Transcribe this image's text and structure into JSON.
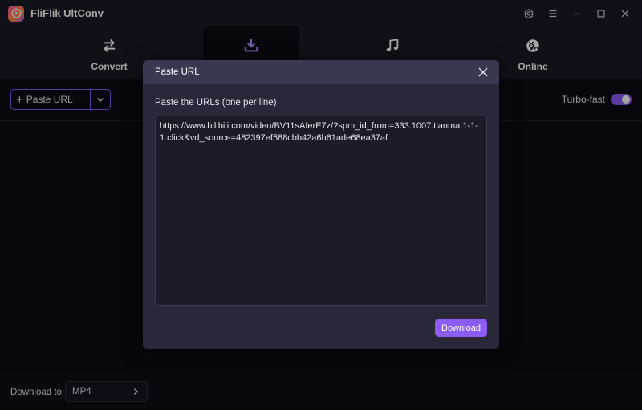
{
  "app": {
    "title": "FliFlik UltConv",
    "logo_icon": "play-logo-icon",
    "brand_gradient": [
      "#ff5fa2",
      "#ff8a3d",
      "#a855f7"
    ]
  },
  "window_controls": [
    {
      "name": "settings",
      "icon": "gear-icon"
    },
    {
      "name": "menu",
      "icon": "hamburger-menu-icon"
    },
    {
      "name": "minimize",
      "icon": "minimize-icon"
    },
    {
      "name": "maximize",
      "icon": "maximize-icon"
    },
    {
      "name": "close",
      "icon": "close-icon"
    }
  ],
  "nav": {
    "tabs": [
      {
        "id": "convert",
        "label": "Convert",
        "icon": "swap-arrows-icon",
        "active": false
      },
      {
        "id": "download",
        "label": "",
        "icon": "download-tray-icon",
        "active": true
      },
      {
        "id": "music",
        "label": "",
        "icon": "music-note-icon",
        "active": false
      },
      {
        "id": "online",
        "label": "Online",
        "icon": "globe-icon",
        "active": false
      }
    ]
  },
  "toolbar": {
    "paste_url_label": "Paste URL",
    "turbo_label": "Turbo-fast",
    "turbo_enabled": true
  },
  "bottom": {
    "download_to_label": "Download to:",
    "format_value": "MP4"
  },
  "dialog": {
    "title": "Paste URL",
    "subtitle": "Paste the URLs (one per line)",
    "url_value": "https://www.bilibili.com/video/BV11sAferE7z/?spm_id_from=333.1007.tianma.1-1-1.click&vd_source=482397ef588cbb42a6b61ade68ea37af",
    "download_label": "Download"
  },
  "colors": {
    "accent": "#8b5cf6",
    "background": "#0b0b15",
    "panel": "#1a1a26",
    "dialog": "#282838",
    "dialog_header": "#383850"
  }
}
